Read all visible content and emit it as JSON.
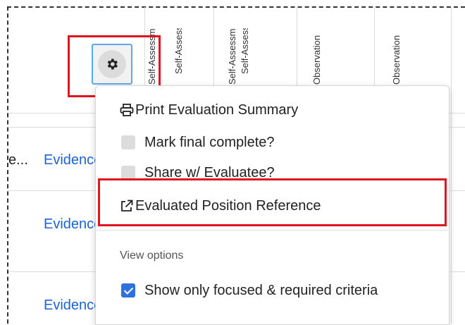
{
  "column_headers": [
    {
      "text": "Self-Assessment"
    },
    {
      "text": "Self-Assessment"
    },
    {
      "text": "Observation"
    },
    {
      "text": "Observation"
    }
  ],
  "rows": [
    {
      "left_text": "e...",
      "link": "Evidence"
    },
    {
      "left_text": "",
      "link": "Evidence"
    },
    {
      "left_text": "",
      "link": "Evidence"
    }
  ],
  "settings_button": {
    "icon": "gear-icon"
  },
  "menu": {
    "items": [
      {
        "label": "Print Evaluation Summary",
        "icon": "print-icon"
      },
      {
        "label": "Mark final complete?",
        "checked": false
      },
      {
        "label": "Share w/ Evaluatee?",
        "checked": false
      },
      {
        "label": "Evaluated Position Reference",
        "icon": "external-link-icon"
      }
    ],
    "section_label": "View options",
    "view_options": [
      {
        "label": "Show only focused & required criteria",
        "checked": true
      }
    ]
  },
  "colors": {
    "highlight": "#e0141e",
    "link": "#1a63d8",
    "checkbox_checked": "#2f6fde"
  }
}
